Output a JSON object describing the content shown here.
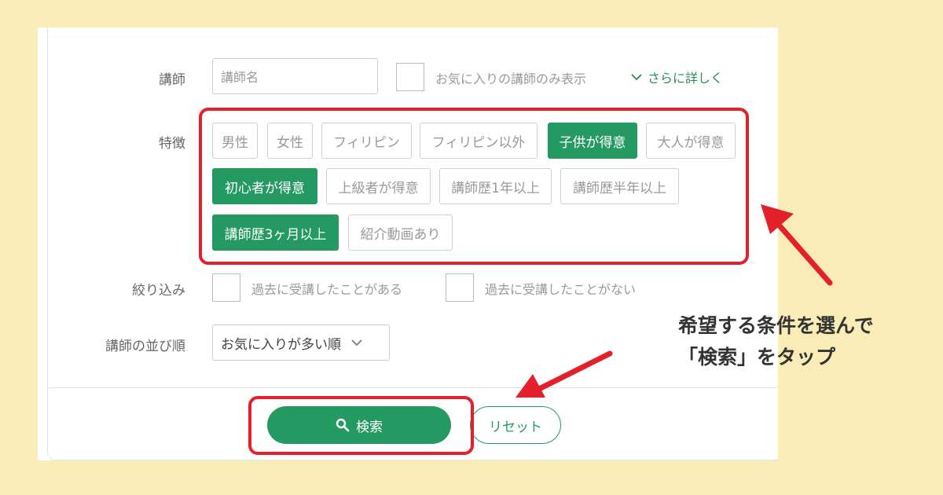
{
  "form": {
    "teacher": {
      "label": "講師",
      "name_placeholder": "講師名",
      "favorites_only_label": "お気に入りの講師のみ表示",
      "more_details_label": "さらに詳しく"
    },
    "features": {
      "label": "特徴",
      "chips": [
        {
          "label": "男性",
          "selected": false
        },
        {
          "label": "女性",
          "selected": false
        },
        {
          "label": "フィリピン",
          "selected": false
        },
        {
          "label": "フィリピン以外",
          "selected": false
        },
        {
          "label": "子供が得意",
          "selected": true
        },
        {
          "label": "大人が得意",
          "selected": false
        },
        {
          "label": "初心者が得意",
          "selected": true
        },
        {
          "label": "上級者が得意",
          "selected": false
        },
        {
          "label": "講師歴1年以上",
          "selected": false
        },
        {
          "label": "講師歴半年以上",
          "selected": false
        },
        {
          "label": "講師歴3ヶ月以上",
          "selected": true
        },
        {
          "label": "紹介動画あり",
          "selected": false
        }
      ]
    },
    "filter": {
      "label": "絞り込み",
      "taken_before_label": "過去に受講したことがある",
      "never_taken_label": "過去に受講したことがない"
    },
    "sort": {
      "label": "講師の並び順",
      "selected": "お気に入りが多い順"
    },
    "actions": {
      "search_label": "検索",
      "reset_label": "リセット"
    }
  },
  "annotation": {
    "line1": "希望する条件を選んで",
    "line2": "「検索」をタップ"
  },
  "colors": {
    "accent_green": "#249a62",
    "highlight_red": "#e4202b",
    "background": "#f9ecb6"
  },
  "icons": [
    "chevron-down-icon",
    "search-icon"
  ]
}
